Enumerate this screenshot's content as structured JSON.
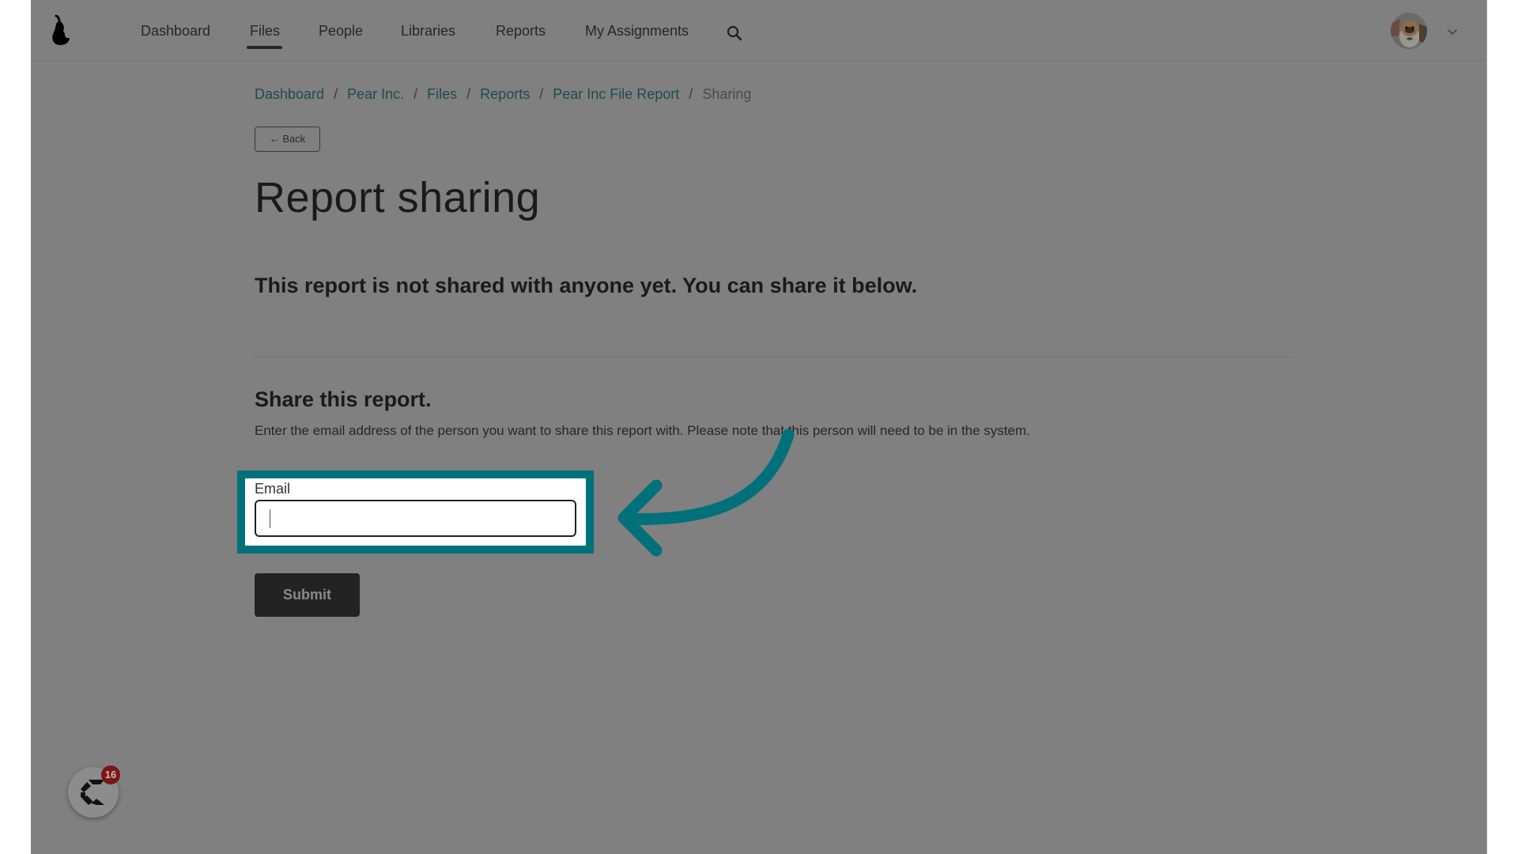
{
  "nav": {
    "items": [
      {
        "label": "Dashboard",
        "active": false
      },
      {
        "label": "Files",
        "active": true
      },
      {
        "label": "People",
        "active": false
      },
      {
        "label": "Libraries",
        "active": false
      },
      {
        "label": "Reports",
        "active": false
      },
      {
        "label": "My Assignments",
        "active": false
      }
    ],
    "search_icon": "search-icon",
    "avatar_icon": "user-avatar",
    "menu_icon": "chevron-down-icon"
  },
  "breadcrumb": {
    "items": [
      "Dashboard",
      "Pear Inc.",
      "Files",
      "Reports",
      "Pear Inc File Report"
    ],
    "current": "Sharing",
    "separator": "/"
  },
  "back_button": {
    "label": "← Back"
  },
  "page": {
    "title": "Report sharing",
    "status_message": "This report is not shared with anyone yet. You can share it below."
  },
  "share": {
    "heading": "Share this report.",
    "description": "Enter the email address of the person you want to share this report with. Please note that this person will need to be in the system.",
    "email_label": "Email",
    "email_value": "",
    "email_placeholder": "",
    "submit_label": "Submit"
  },
  "annotation": {
    "highlight_color": "#00717a",
    "arrow_color": "#00717a"
  },
  "chat_widget": {
    "badge_count": "16"
  }
}
